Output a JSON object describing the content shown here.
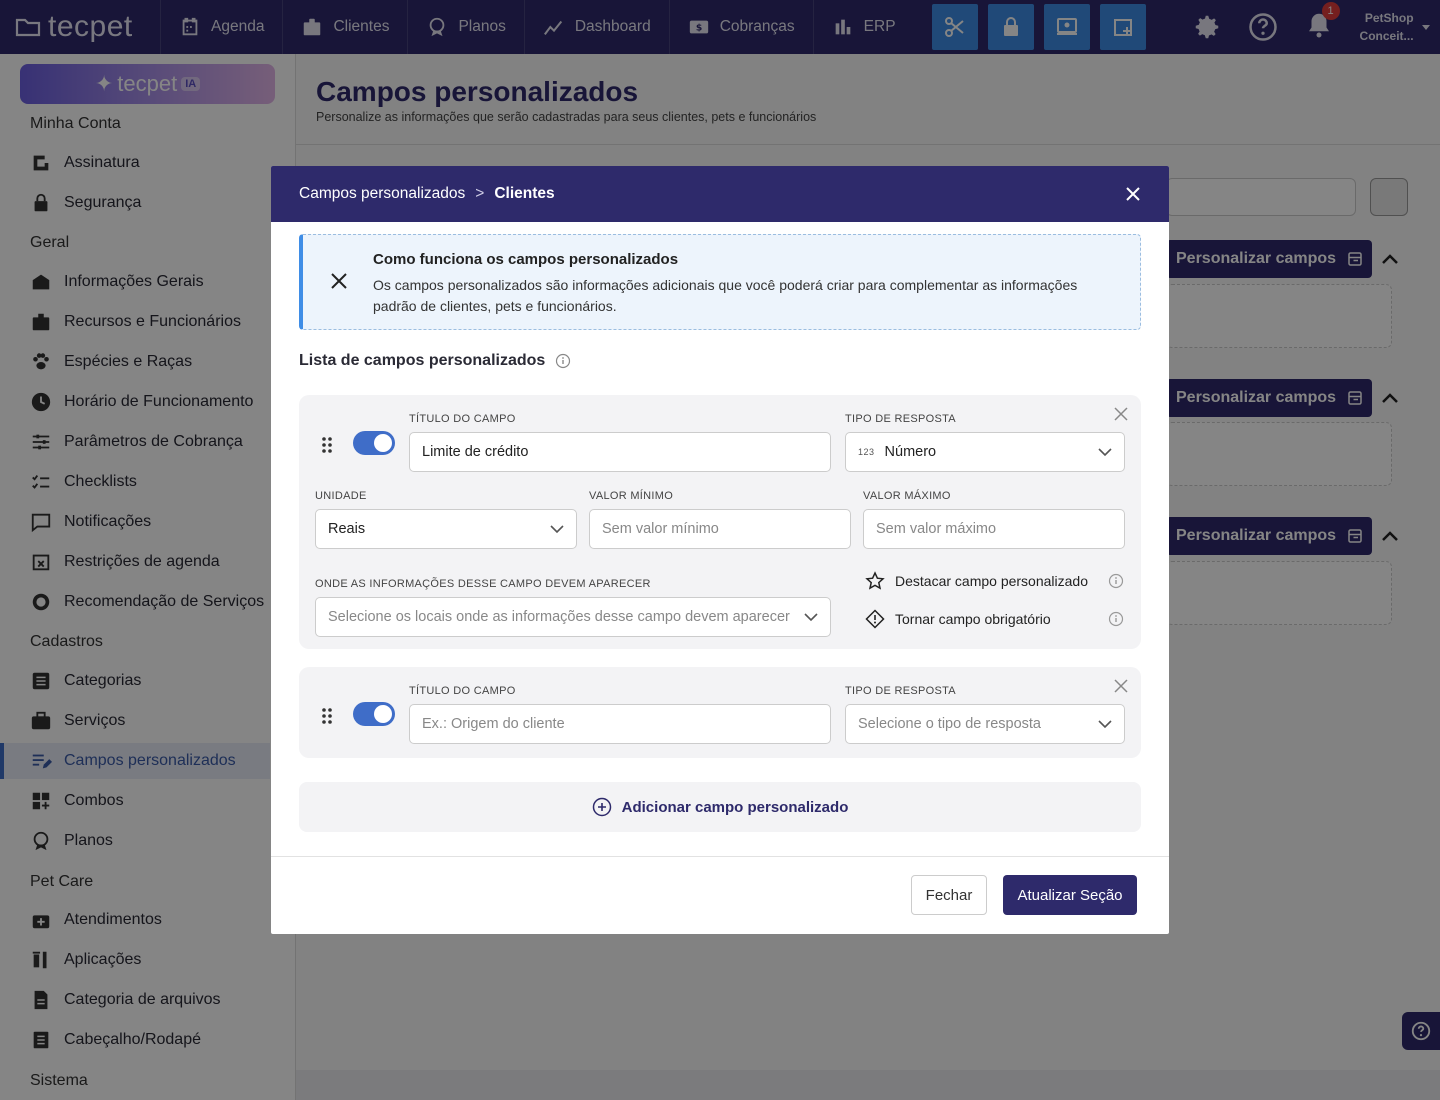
{
  "topbar": {
    "logo": "tecpet",
    "nav": [
      "Agenda",
      "Clientes",
      "Planos",
      "Dashboard",
      "Cobranças",
      "ERP"
    ],
    "notification_count": "1",
    "user_line1": "PetShop",
    "user_line2": "Conceit..."
  },
  "sidebar": {
    "ia_logo": "tecpet",
    "ia_tag": "IA",
    "sections": [
      "Minha Conta",
      "Geral",
      "Cadastros",
      "Pet Care",
      "Sistema"
    ],
    "items": [
      "Assinatura",
      "Segurança",
      "Informações Gerais",
      "Recursos e Funcionários",
      "Espécies e Raças",
      "Horário de Funcionamento",
      "Parâmetros de Cobrança",
      "Checklists",
      "Notificações",
      "Restrições de agenda",
      "Recomendação de Serviços",
      "Categorias",
      "Serviços",
      "Campos personalizados",
      "Combos",
      "Planos",
      "Atendimentos",
      "Aplicações",
      "Categoria de arquivos",
      "Cabeçalho/Rodapé"
    ]
  },
  "page": {
    "title": "Campos personalizados",
    "subtitle": "Personalize as informações que serão cadastradas para seus clientes, pets e funcionários",
    "personalize_label": "Personalizar campos"
  },
  "modal": {
    "breadcrumb_root": "Campos personalizados",
    "breadcrumb_sep": ">",
    "breadcrumb_current": "Clientes",
    "info_title": "Como funciona os campos personalizados",
    "info_text": "Os campos personalizados são informações adicionais que você poderá criar para complementar as informações padrão de clientes, pets e funcionários.",
    "list_title": "Lista de campos personalizados",
    "field1": {
      "title_label": "Título do campo",
      "title_value": "Limite de crédito",
      "type_label": "Tipo de resposta",
      "type_icon": "123",
      "type_value": "Número",
      "unit_label": "Unidade",
      "unit_value": "Reais",
      "min_label": "Valor mínimo",
      "min_placeholder": "Sem valor mínimo",
      "max_label": "Valor máximo",
      "max_placeholder": "Sem valor máximo",
      "where_label": "Onde as informações desse campo devem aparecer",
      "where_placeholder": "Selecione os locais onde as informações desse campo devem aparecer",
      "highlight_label": "Destacar campo personalizado",
      "required_label": "Tornar campo obrigatório"
    },
    "field2": {
      "title_label": "Título do campo",
      "title_placeholder": "Ex.: Origem do cliente",
      "type_label": "Tipo de resposta",
      "type_placeholder": "Selecione o tipo de resposta"
    },
    "add_label": "Adicionar campo personalizado",
    "close_label": "Fechar",
    "update_label": "Atualizar Seção"
  },
  "colors": {
    "primary": "#2e2a6b",
    "accent": "#3f8de6",
    "toggle": "#3f6dc8"
  }
}
